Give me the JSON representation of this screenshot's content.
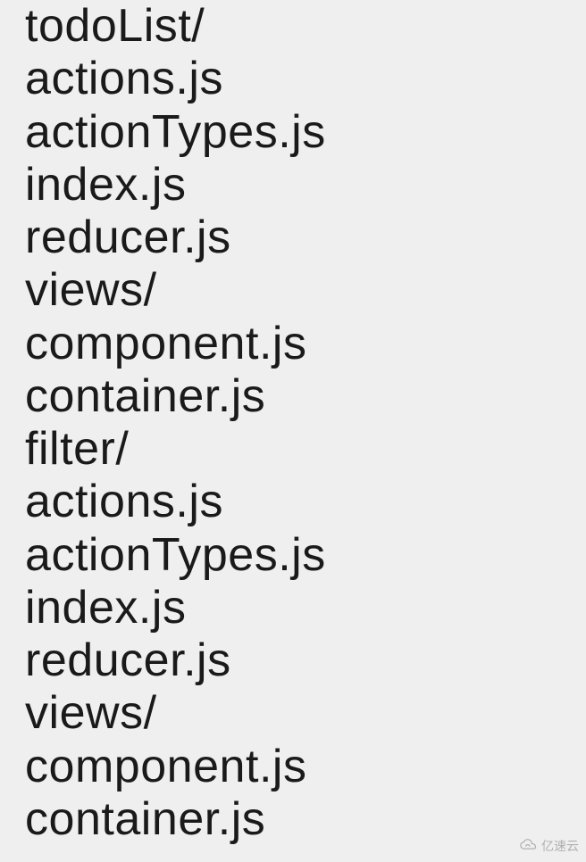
{
  "lines": [
    "todoList/",
    "actions.js",
    "actionTypes.js",
    "index.js",
    "reducer.js",
    "views/",
    "component.js",
    "container.js",
    "filter/",
    "actions.js",
    "actionTypes.js",
    "index.js",
    "reducer.js",
    "views/",
    "component.js",
    "container.js"
  ],
  "watermark": "亿速云"
}
